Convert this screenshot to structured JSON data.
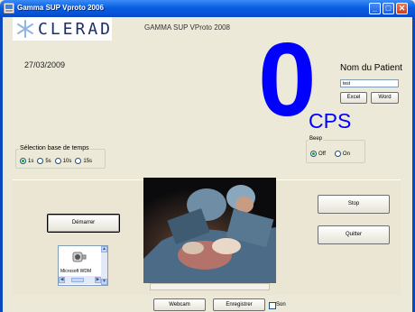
{
  "window": {
    "title": "Gamma SUP Vproto 2006",
    "controls": [
      "minimize",
      "maximize",
      "close"
    ]
  },
  "header": {
    "logo_text": "CLERAD",
    "app_heading": "GAMMA SUP VProto 2008"
  },
  "date": "27/03/2009",
  "counter": {
    "value": "0",
    "unit": "CPS"
  },
  "patient": {
    "title": "Nom du Patient",
    "name_value": "test",
    "excel_label": "Excel",
    "word_label": "Word"
  },
  "time_base": {
    "legend": "Sélection base de temps",
    "options": [
      "1s",
      "5s",
      "10s",
      "15s"
    ],
    "selected": "1s"
  },
  "beep": {
    "legend": "Beep",
    "options": [
      "Off",
      "On"
    ],
    "selected": "Off"
  },
  "buttons": {
    "start": "Démarrer",
    "stop": "Stop",
    "quit": "Quitter",
    "webcam": "Webcam",
    "record": "Enregistrer"
  },
  "sound": {
    "label": "Son",
    "checked": false
  },
  "camera": {
    "device_name": "Microsoft WDM"
  },
  "colors": {
    "counter": "#0000ff",
    "titlebar": "#0552d8",
    "background": "#ece9d8"
  }
}
